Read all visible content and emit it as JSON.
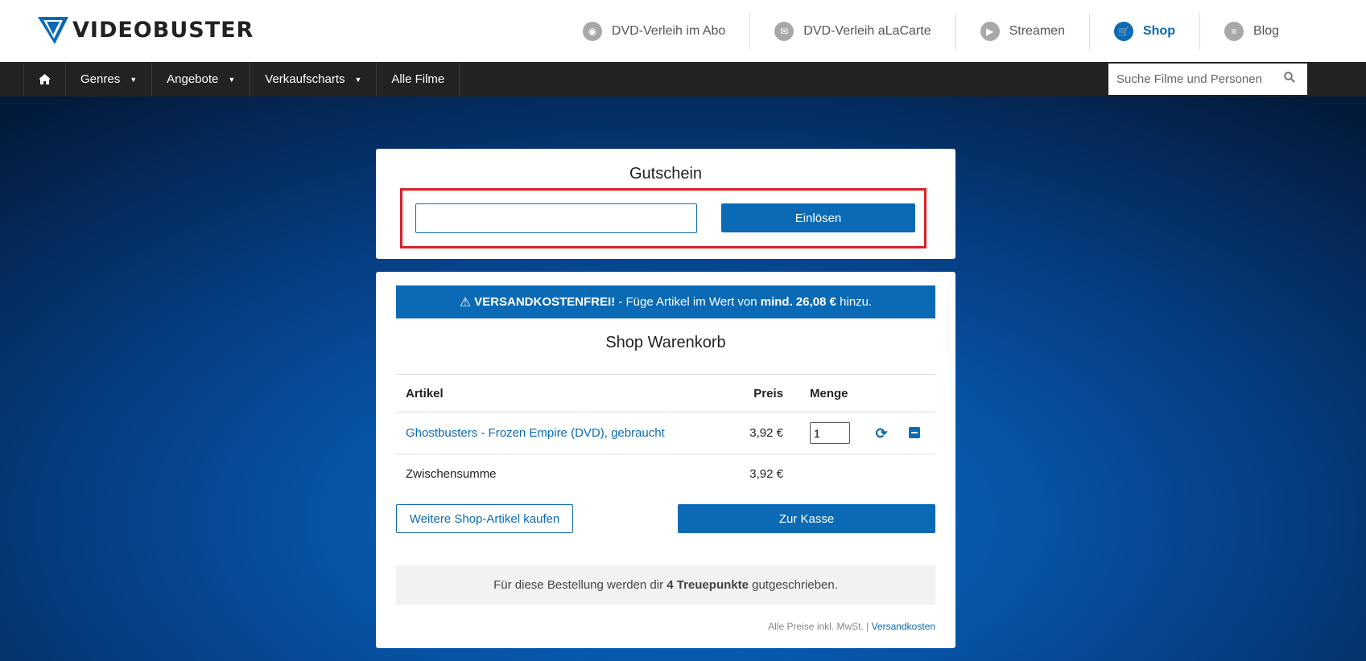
{
  "brand": {
    "name": "VIDEOBUSTER"
  },
  "topnav": [
    {
      "label": "DVD-Verleih im Abo",
      "icon": "disc-icon",
      "active": false
    },
    {
      "label": "DVD-Verleih aLaCarte",
      "icon": "mail-icon",
      "active": false
    },
    {
      "label": "Streamen",
      "icon": "cloud-play-icon",
      "active": false
    },
    {
      "label": "Shop",
      "icon": "cart-icon",
      "active": true
    },
    {
      "label": "Blog",
      "icon": "blog-icon",
      "active": false
    }
  ],
  "menu": {
    "home_icon": "home-icon",
    "items": [
      {
        "label": "Genres",
        "dropdown": true
      },
      {
        "label": "Angebote",
        "dropdown": true
      },
      {
        "label": "Verkaufscharts",
        "dropdown": true
      },
      {
        "label": "Alle Filme",
        "dropdown": false
      }
    ],
    "search_placeholder": "Suche Filme und Personen"
  },
  "voucher": {
    "title": "Gutschein",
    "input_value": "",
    "redeem_label": "Einlösen"
  },
  "shipping_banner": {
    "strong": "VERSANDKOSTENFREI!",
    "text": " - Füge Artikel im Wert von ",
    "amount": "mind. 26,08 €",
    "suffix": " hinzu."
  },
  "cart": {
    "title": "Shop Warenkorb",
    "columns": {
      "article": "Artikel",
      "price": "Preis",
      "quantity": "Menge"
    },
    "items": [
      {
        "name": "Ghostbusters - Frozen Empire (DVD), gebraucht",
        "price": "3,92 €",
        "quantity": "1"
      }
    ],
    "subtotal_label": "Zwischensumme",
    "subtotal_value": "3,92 €",
    "more_button": "Weitere Shop-Artikel kaufen",
    "checkout_button": "Zur Kasse"
  },
  "loyalty": {
    "prefix": "Für diese Bestellung werden dir ",
    "points": "4 Treuepunkte",
    "suffix": " gutgeschrieben."
  },
  "footnote": {
    "text": "Alle Preise inkl. MwSt. | ",
    "link": "Versandkosten"
  },
  "colors": {
    "accent": "#0a6ab5",
    "highlight": "#d92027",
    "menubar": "#222222"
  }
}
